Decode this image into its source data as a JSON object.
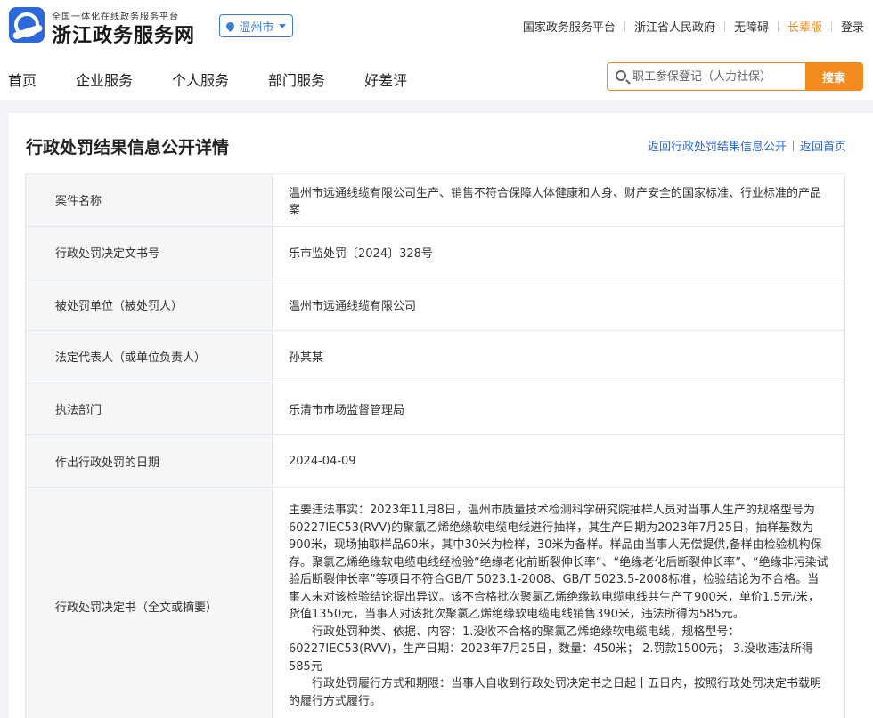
{
  "header": {
    "platform_small": "全国一体化在线政务服务平台",
    "site_name": "浙江政务服务网",
    "city": "温州市",
    "links": [
      "国家政务服务平台",
      "浙江省人民政府",
      "无障碍",
      "长辈版",
      "登录"
    ]
  },
  "nav": {
    "items": [
      "首页",
      "企业服务",
      "个人服务",
      "部门服务",
      "好差评"
    ]
  },
  "search": {
    "placeholder": "职工参保登记（人力社保）",
    "button_label": "搜索"
  },
  "detail": {
    "title": "行政处罚结果信息公开详情",
    "back_list_link": "返回行政处罚结果信息公开",
    "back_home_link": "返回首页",
    "rows": [
      {
        "label": "案件名称",
        "value": "温州市远通线缆有限公司生产、销售不符合保障人体健康和人身、财产安全的国家标准、行业标准的产品案"
      },
      {
        "label": "行政处罚决定文书号",
        "value": "乐市监处罚〔2024〕328号"
      },
      {
        "label": "被处罚单位（被处罚人）",
        "value": "温州市远通线缆有限公司"
      },
      {
        "label": "法定代表人（或单位负责人）",
        "value": "孙某某"
      },
      {
        "label": "执法部门",
        "value": "乐清市市场监督管理局"
      },
      {
        "label": "作出行政处罚的日期",
        "value": "2024-04-09"
      }
    ],
    "decision": {
      "label": "行政处罚决定书（全文或摘要）",
      "paragraphs": [
        "主要违法事实：2023年11月8日，温州市质量技术检测科学研究院抽样人员对当事人生产的规格型号为60227IEC53(RVV)的聚氯乙烯绝缘软电缆电线进行抽样，其生产日期为2023年7月25日，抽样基数为900米，现场抽取样品60米，其中30米为检样，30米为备样。样品由当事人无偿提供,备样由检验机构保存。聚氯乙烯绝缘软电缆电线经检验“绝缘老化前断裂伸长率”、“绝缘老化后断裂伸长率”、“绝缘非污染试验后断裂伸长率”等项目不符合GB/T 5023.1-2008、GB/T 5023.5-2008标准，检验结论为不合格。当事人未对该检验结论提出异议。该不合格批次聚氯乙烯绝缘软电缆电线共生产了900米，单价1.5元/米，货值1350元，当事人对该批次聚氯乙烯绝缘软电缆电线销售390米，违法所得为585元。",
        "行政处罚种类、依据、内容：1.没收不合格的聚氯乙烯绝缘软电缆电线，规格型号：60227IEC53(RVV)，生产日期：2023年7月25日，数量：450米； 2.罚款1500元； 3.没收违法所得585元",
        "行政处罚履行方式和期限：当事人自收到行政处罚决定书之日起十五日内，按照行政处罚决定书载明的履行方式履行。"
      ]
    }
  },
  "colors": {
    "brand_blue": "#2b6ad8",
    "accent_orange": "#f38a1d"
  },
  "icons": {
    "logo": "zhejiang-gov-logo",
    "city": "location-pin-icon",
    "search": "search-icon"
  }
}
